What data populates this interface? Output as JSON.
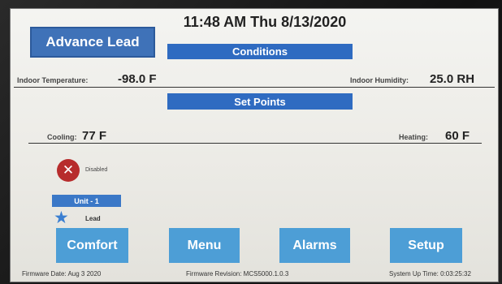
{
  "header": {
    "clock": "11:48 AM Thu 8/13/2020",
    "advance_button": "Advance Lead"
  },
  "conditions": {
    "title": "Conditions",
    "indoor_temp_label": "Indoor Temperature:",
    "indoor_temp_value": "-98.0 F",
    "indoor_humidity_label": "Indoor Humidity:",
    "indoor_humidity_value": "25.0 RH"
  },
  "setpoints": {
    "title": "Set Points",
    "cooling_label": "Cooling:",
    "cooling_value": "77 F",
    "heating_label": "Heating:",
    "heating_value": "60 F"
  },
  "unit": {
    "status_label": "Disabled",
    "status_icon": "x-circle-icon",
    "name": "Unit - 1",
    "role_icon": "star-icon",
    "role": "Lead"
  },
  "nav": {
    "comfort": "Comfort",
    "menu": "Menu",
    "alarms": "Alarms",
    "setup": "Setup"
  },
  "footer": {
    "firmware_date": "Firmware Date: Aug  3 2020",
    "firmware_revision": "Firmware Revision: MCS5000.1.0.3",
    "uptime": "System Up Time: 0:03:25:32"
  },
  "colors": {
    "accent_blue": "#2f6bc1",
    "nav_blue": "#4d9ed6",
    "disabled_red": "#b72c2c"
  }
}
